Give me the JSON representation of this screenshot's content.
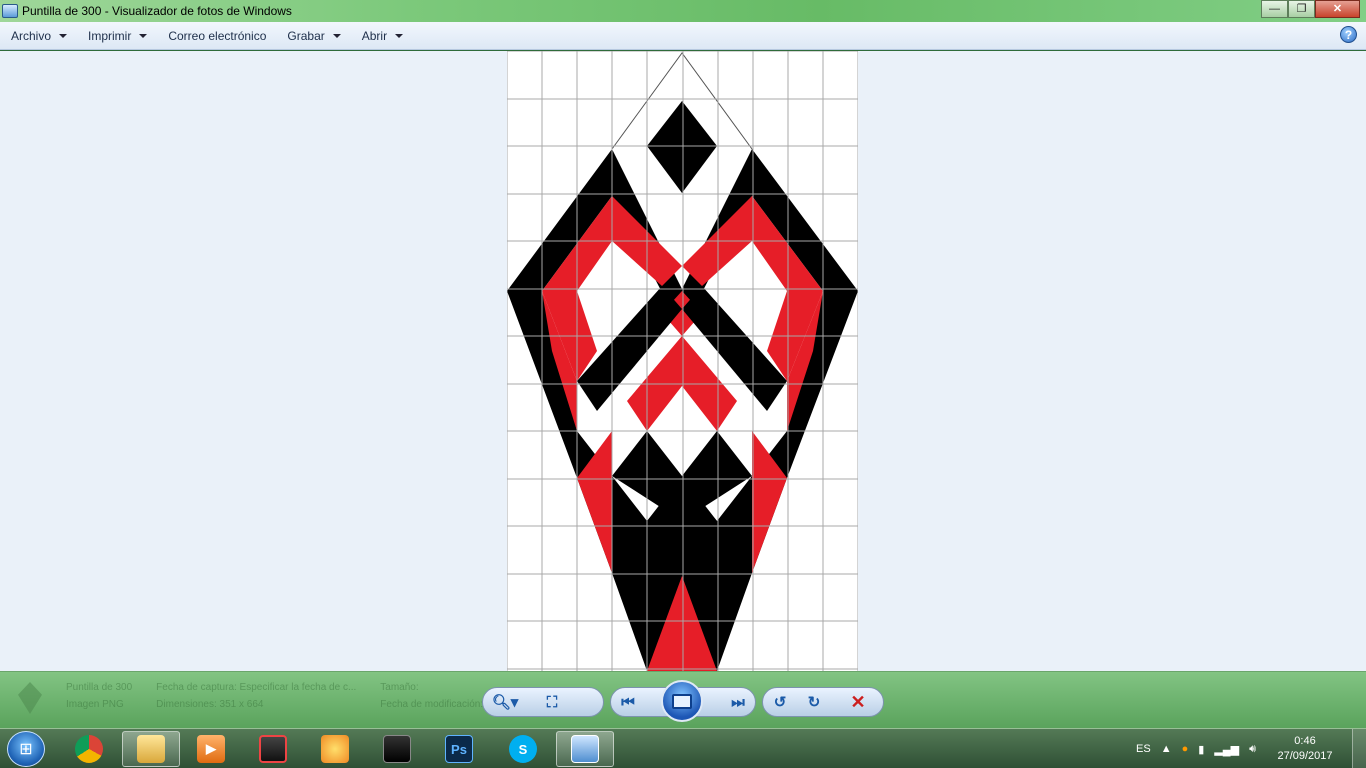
{
  "window": {
    "title": "Puntilla de 300 - Visualizador de fotos de Windows",
    "minimize_symbol": "—",
    "restore_symbol": "❐",
    "close_symbol": "✕"
  },
  "menu": {
    "items": [
      {
        "label": "Archivo",
        "dropdown": true
      },
      {
        "label": "Imprimir",
        "dropdown": true
      },
      {
        "label": "Correo electrónico",
        "dropdown": false
      },
      {
        "label": "Grabar",
        "dropdown": true
      },
      {
        "label": "Abrir",
        "dropdown": true
      }
    ],
    "help_symbol": "?"
  },
  "image": {
    "grid_color": "#a8a8a8",
    "black": "#000000",
    "red": "#e61e28"
  },
  "info_panel": {
    "filename": "Puntilla de 300",
    "capture_label": "Fecha de captura: Especificar la fecha de c...",
    "type": "Imagen PNG",
    "dimensions": "Dimensiones: 351 x 664",
    "size_label": "Tamaño:",
    "modified_label": "Fecha de modificación:"
  },
  "controls": {
    "zoom_icon": "search-plus-icon",
    "fit_icon": "fit-to-window-icon",
    "previous_icon": "previous-icon",
    "slideshow_icon": "slideshow-icon",
    "next_icon": "next-icon",
    "rotate_left_icon": "rotate-ccw-icon",
    "rotate_right_icon": "rotate-cw-icon",
    "delete_icon": "delete-icon"
  },
  "taskbar": {
    "apps": [
      "Chrome",
      "Explorador de archivos",
      "Reproductor",
      "Cámara",
      "Paint",
      "Pantalla",
      "Photoshop",
      "Skype",
      "Visualizador de fotos"
    ],
    "ps_label": "Ps",
    "language": "ES",
    "time": "0:46",
    "date": "27/09/2017"
  }
}
